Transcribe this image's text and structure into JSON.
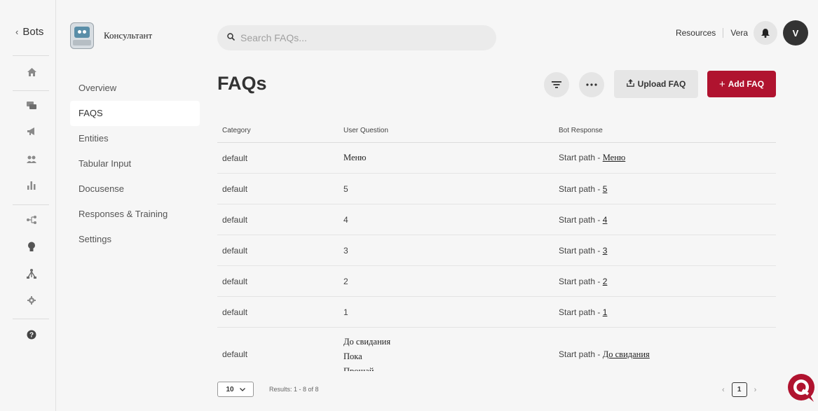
{
  "rail": {
    "back_label": "Bots",
    "icons": [
      "home-icon",
      "chat-icon",
      "megaphone-icon",
      "users-icon",
      "bar-chart-icon",
      "flow-icon",
      "lightbulb-icon",
      "hierarchy-icon",
      "gear-icon",
      "help-icon"
    ]
  },
  "bot": {
    "name": "Консультант"
  },
  "nav": {
    "items": [
      "Overview",
      "FAQS",
      "Entities",
      "Tabular Input",
      "Docusense",
      "Responses & Training",
      "Settings"
    ],
    "active": "FAQS"
  },
  "search": {
    "placeholder": "Search FAQs..."
  },
  "header": {
    "resources": "Resources",
    "user_name": "Vera",
    "avatar_initial": "V"
  },
  "page": {
    "title": "FAQs",
    "upload_label": "Upload FAQ",
    "add_label": "Add FAQ"
  },
  "table": {
    "headers": [
      "Category",
      "User Question",
      "Bot Response"
    ],
    "response_prefix": "Start path  -",
    "rows": [
      {
        "category": "default",
        "question": "Меню",
        "response_link": "Меню"
      },
      {
        "category": "default",
        "question": "5",
        "response_link": "5"
      },
      {
        "category": "default",
        "question": "4",
        "response_link": "4"
      },
      {
        "category": "default",
        "question": "3",
        "response_link": "3"
      },
      {
        "category": "default",
        "question": "2",
        "response_link": "2"
      },
      {
        "category": "default",
        "question": "1",
        "response_link": "1"
      }
    ],
    "last_row": {
      "category": "default",
      "questions": [
        "До свидания",
        "Пока",
        "Прощай"
      ],
      "response_link": "До свидания"
    }
  },
  "footer": {
    "page_size": "10",
    "results": "Results: 1 - 8 of 8",
    "current_page": "1"
  },
  "colors": {
    "accent": "#b0132f",
    "background": "#f6f6f6",
    "avatar": "#333333"
  }
}
